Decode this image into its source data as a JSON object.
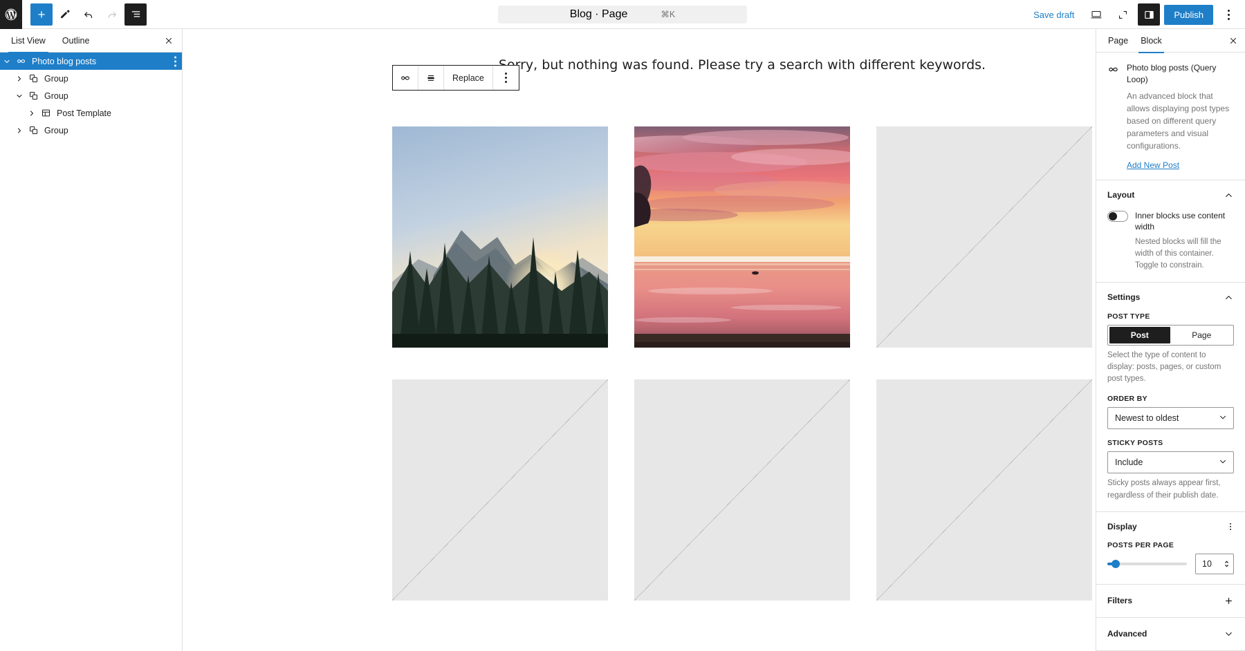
{
  "topbar": {
    "logo_icon": "wordpress-logo-icon",
    "add_block_icon": "plus-icon",
    "tools_icon": "pencil-icon",
    "undo_icon": "undo-arrow-icon",
    "redo_icon": "redo-arrow-icon",
    "list_view_icon": "list-view-icon",
    "command_title": "Blog · Page",
    "command_shortcut": "⌘K",
    "save_draft_label": "Save draft",
    "preview_icon": "desktop-preview-icon",
    "fullscreen_icon": "expand-icon",
    "settings_panel_icon": "sidebar-panel-icon",
    "publish_label": "Publish",
    "options_icon": "ellipsis-vertical-icon",
    "accent_color": "#1e7ec8",
    "dark_color": "#1e1e1e"
  },
  "list_view": {
    "tabs": [
      {
        "label": "List View",
        "active": true
      },
      {
        "label": "Outline",
        "active": false
      }
    ],
    "close_icon": "close-icon",
    "rows": [
      {
        "label": "Photo blog posts",
        "icon": "query-loop-icon",
        "chevron": "down",
        "depth": 0,
        "selected": true,
        "has_more": true
      },
      {
        "label": "Group",
        "icon": "group-icon",
        "chevron": "right",
        "depth": 1,
        "selected": false,
        "has_more": false
      },
      {
        "label": "Group",
        "icon": "group-icon",
        "chevron": "down",
        "depth": 1,
        "selected": false,
        "has_more": false
      },
      {
        "label": "Post Template",
        "icon": "post-template-icon",
        "chevron": "right",
        "depth": 2,
        "selected": false,
        "has_more": false
      },
      {
        "label": "Group",
        "icon": "group-icon",
        "chevron": "right",
        "depth": 1,
        "selected": false,
        "has_more": false
      }
    ]
  },
  "canvas": {
    "block_toolbar": {
      "block_icon": "query-loop-icon",
      "align_icon": "align-center-icon",
      "replace_label": "Replace",
      "more_icon": "ellipsis-vertical-icon"
    },
    "notice_text": "Sorry, but nothing was found. Please try a search with different keywords.",
    "cells": [
      {
        "type": "photo",
        "name": "mountain-sunrise-photo"
      },
      {
        "type": "photo",
        "name": "beach-sunset-photo"
      },
      {
        "type": "placeholder",
        "name": "image-placeholder"
      },
      {
        "type": "placeholder",
        "name": "image-placeholder"
      },
      {
        "type": "placeholder",
        "name": "image-placeholder"
      },
      {
        "type": "placeholder",
        "name": "image-placeholder"
      }
    ],
    "placeholder_color": "#e7e7e7"
  },
  "inspector": {
    "tabs": [
      {
        "label": "Page",
        "active": false
      },
      {
        "label": "Block",
        "active": true
      }
    ],
    "close_icon": "close-icon",
    "block": {
      "icon": "query-loop-icon",
      "title": "Photo blog posts (Query Loop)",
      "description": "An advanced block that allows displaying post types based on different query parameters and visual configurations.",
      "link_label": "Add New Post"
    },
    "layout": {
      "title": "Layout",
      "chevron": "up",
      "toggle_label": "Inner blocks use content width",
      "toggle_on": false,
      "help": "Nested blocks will fill the width of this container. Toggle to constrain."
    },
    "settings": {
      "title": "Settings",
      "chevron": "up",
      "post_type_label": "POST TYPE",
      "post_type_options": [
        "Post",
        "Page"
      ],
      "post_type_selected": "Post",
      "post_type_help": "Select the type of content to display: posts, pages, or custom post types.",
      "order_by_label": "ORDER BY",
      "order_by_value": "Newest to oldest",
      "sticky_label": "STICKY POSTS",
      "sticky_value": "Include",
      "sticky_help": "Sticky posts always appear first, regardless of their publish date."
    },
    "display": {
      "title": "Display",
      "more_icon": "ellipsis-vertical-icon",
      "posts_per_page_label": "POSTS PER PAGE",
      "posts_per_page_value": "10",
      "slider_percent": 6
    },
    "filters": {
      "title": "Filters",
      "icon": "plus-icon"
    },
    "advanced": {
      "title": "Advanced",
      "chevron": "down"
    }
  }
}
